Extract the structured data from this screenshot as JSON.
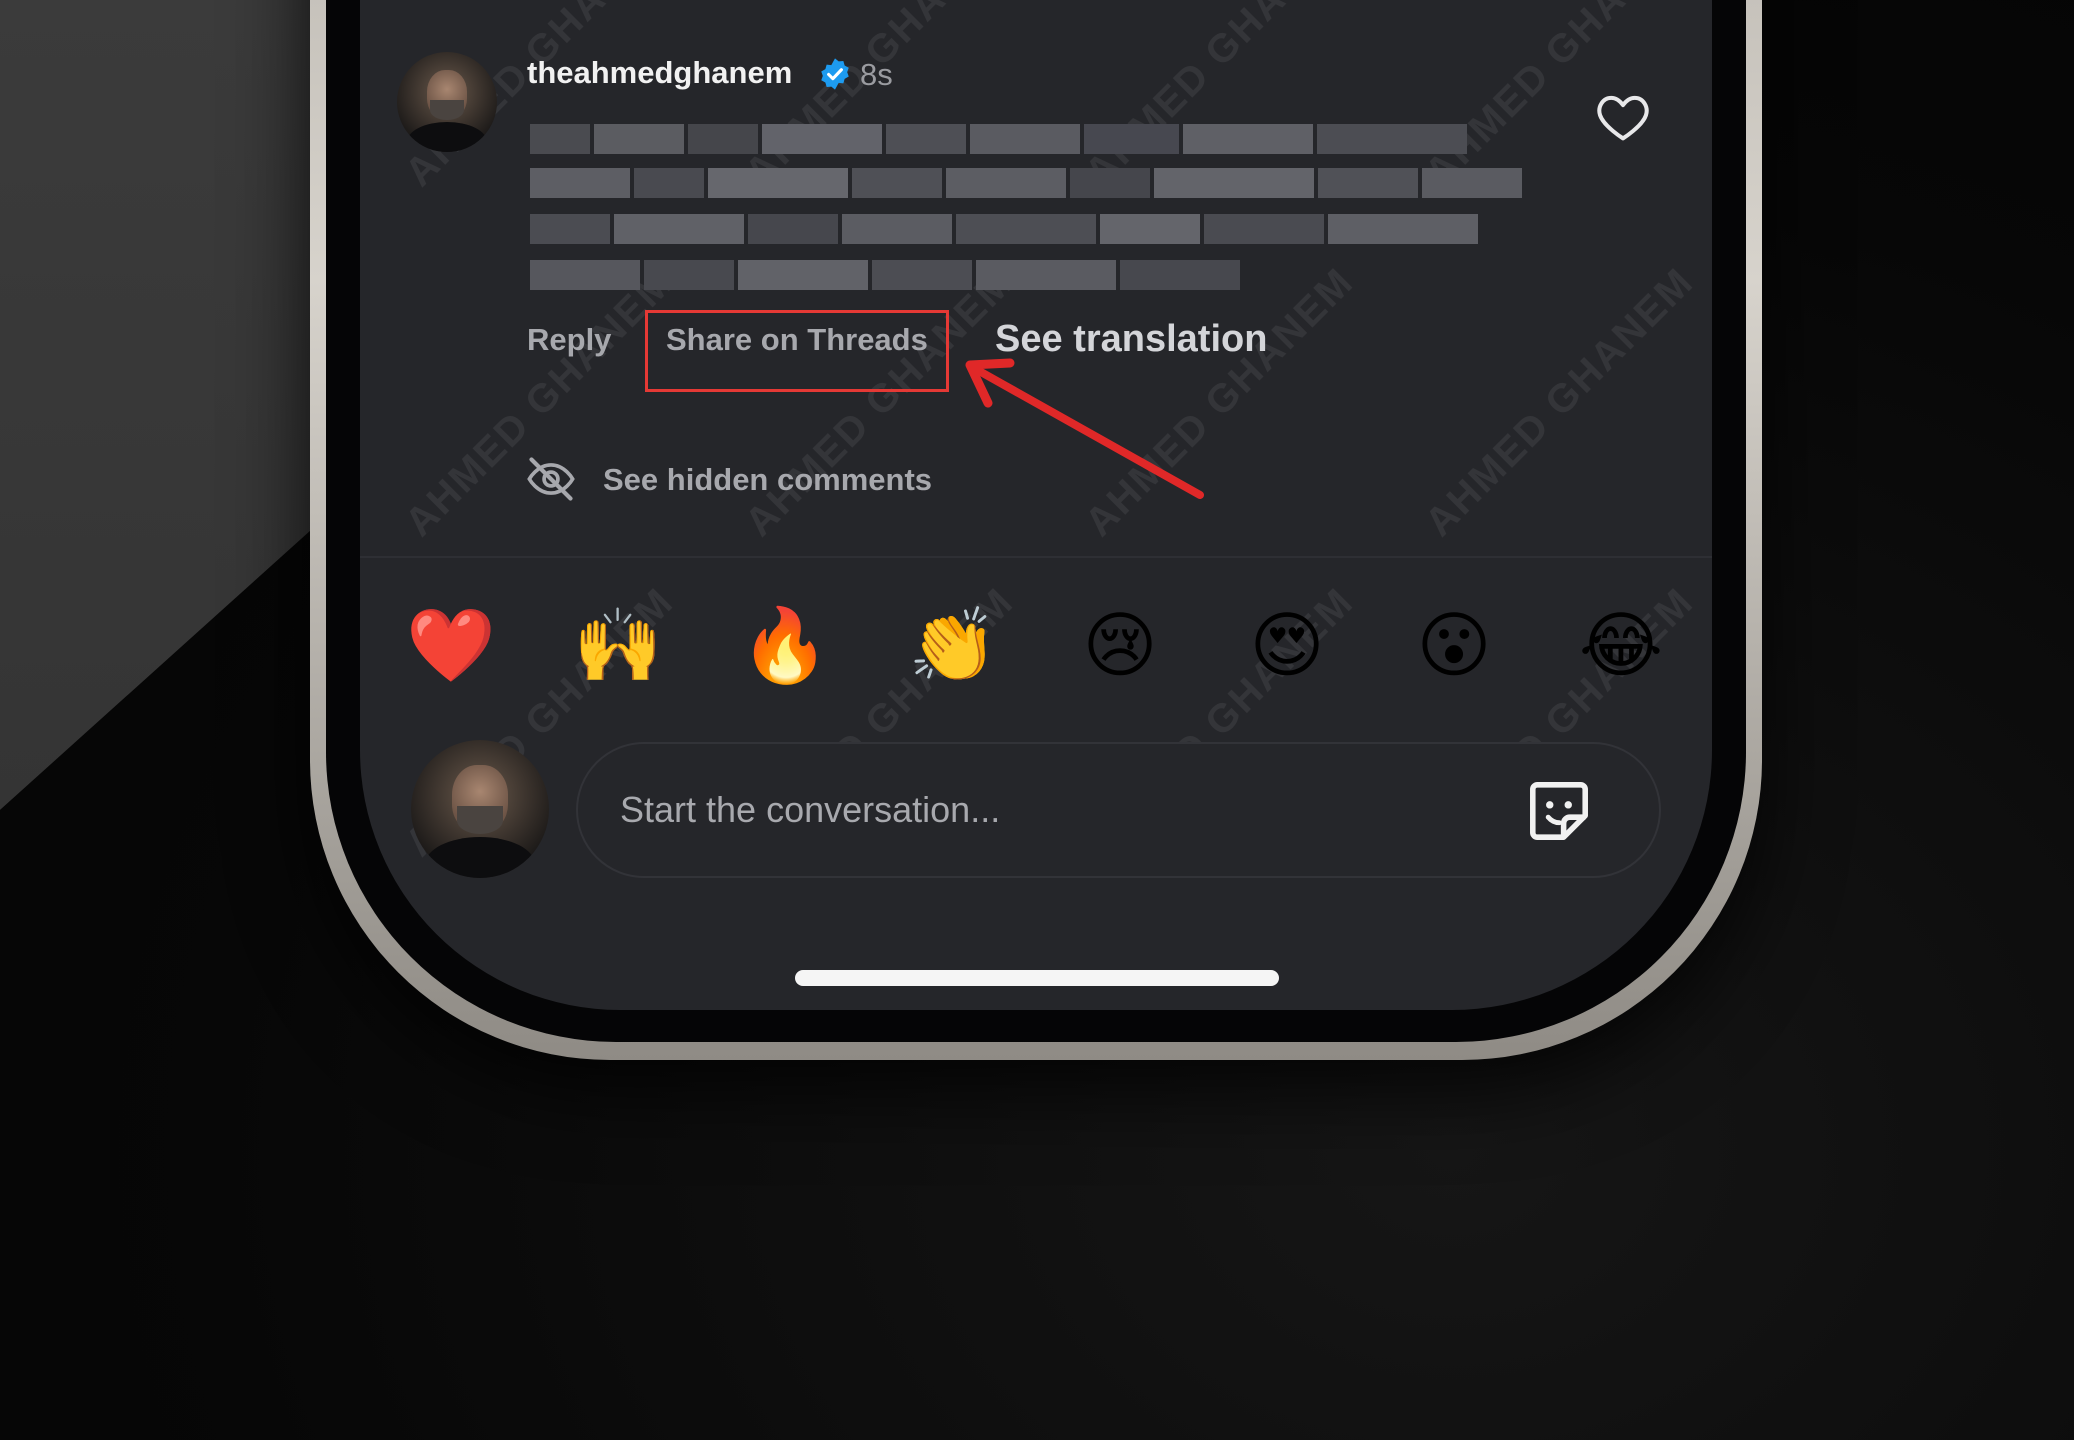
{
  "post": {
    "username": "theahmedghanem",
    "time": "8s",
    "verified_color": "#1d9bf0"
  },
  "actions": {
    "reply": "Reply",
    "share": "Share on Threads",
    "translate": "See translation"
  },
  "hidden_comments": {
    "label": "See hidden comments"
  },
  "reactions": [
    "❤️",
    "🙌",
    "🔥",
    "👏",
    "😢",
    "😍",
    "😮",
    "😂"
  ],
  "composer": {
    "placeholder": "Start the conversation..."
  },
  "watermark": "AHMED GHANEM",
  "colors": {
    "highlight": "#e53935",
    "screen_bg": "#25262a"
  },
  "icons": [
    "heart-outline-icon",
    "verified-badge-icon",
    "eye-off-icon",
    "sticker-icon",
    "arrow-annotation-icon"
  ]
}
